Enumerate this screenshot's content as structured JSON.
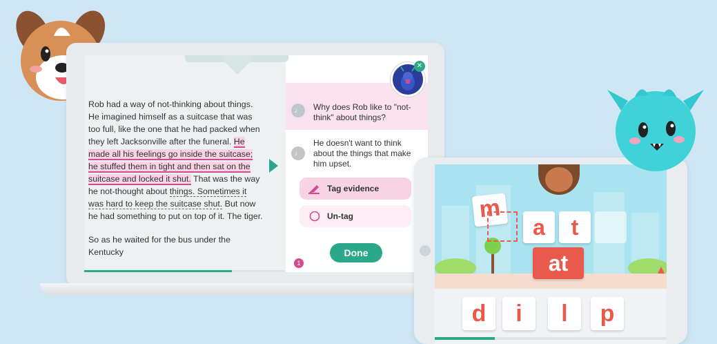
{
  "reading_app": {
    "passage": {
      "p1": {
        "before": "Rob had a way of not-thinking about things. He imagined himself as a suitcase that was too full, like the one that he had packed when they left Jacksonville after the funeral. ",
        "highlighted": "He made all his feelings go inside the suitcase; he stuffed them in tight and then sat on the suitcase and locked it shut.",
        "mid": " That was the way he not-thought about ",
        "underlined": "things. Sometimes it was hard to keep the suitcase shut.",
        "after": " But now he had something to put on top of it. The tiger."
      },
      "p2": "So as he waited for the bus under the Kentucky"
    },
    "question": "Why does Rob like to \"not-think\" about things?",
    "answer": "He doesn't want to think about the things that make him upset.",
    "tag_label": "Tag evidence",
    "untag_label": "Un-tag",
    "done_label": "Done",
    "badge_count": "1",
    "progress_fraction": 0.43,
    "icons": [
      "speaker-icon",
      "highlighter-icon",
      "radio-circle-icon",
      "close-icon",
      "next-arrow-icon"
    ],
    "colors": {
      "accent": "#2aa889",
      "highlight": "#d14b8f",
      "highlight_bg": "#f8d3e4"
    }
  },
  "phonics_game": {
    "dragged_letter": "m",
    "word_tiles": [
      "a",
      "t"
    ],
    "blend_tile": "at",
    "choice_tiles": [
      "d",
      "i",
      "l",
      "p"
    ],
    "progress_fraction": 0.26,
    "colors": {
      "letter_red": "#ea5a4c",
      "sky": "#a9e3ef"
    }
  },
  "mascots": [
    "puppy-mascot",
    "teal-monster-mascot"
  ]
}
